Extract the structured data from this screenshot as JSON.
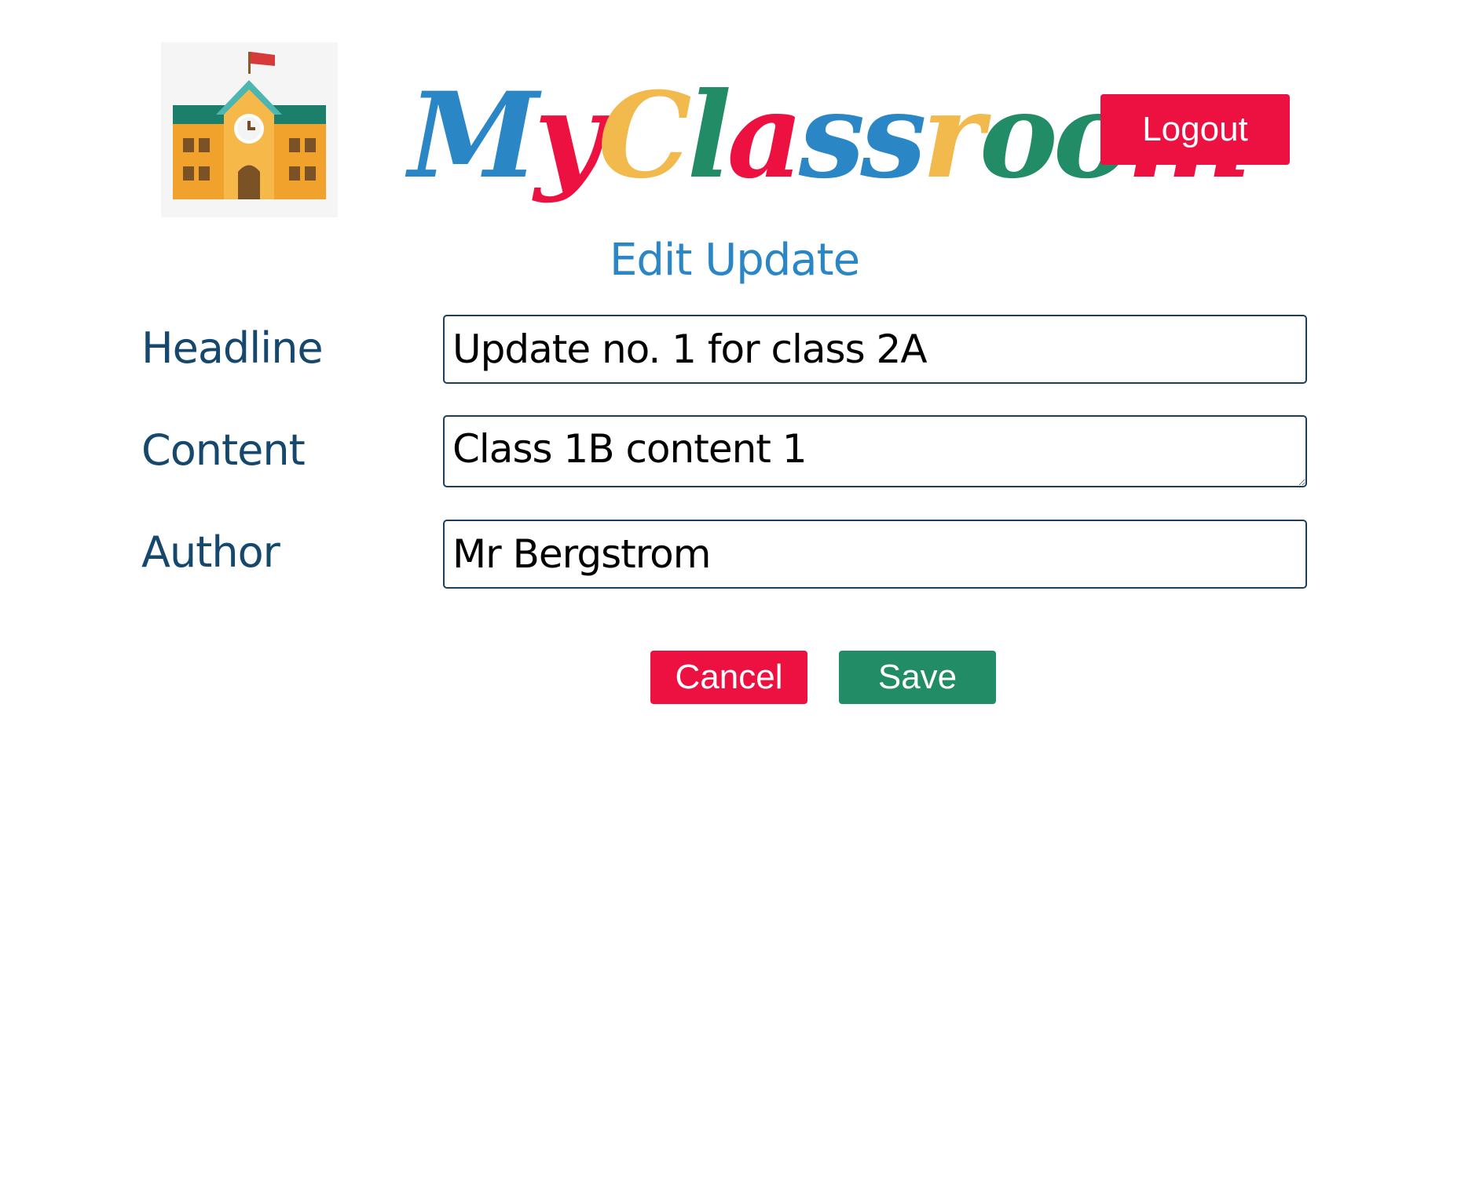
{
  "header": {
    "brand_letters": [
      {
        "char": "M",
        "color": "#2a86c5"
      },
      {
        "char": "y",
        "color": "#ec1140"
      },
      {
        "char": "C",
        "color": "#f2b94c"
      },
      {
        "char": "l",
        "color": "#218c66"
      },
      {
        "char": "a",
        "color": "#ec1140"
      },
      {
        "char": "s",
        "color": "#2a86c5"
      },
      {
        "char": "s",
        "color": "#2a86c5"
      },
      {
        "char": "r",
        "color": "#f2b94c"
      },
      {
        "char": "o",
        "color": "#218c66"
      },
      {
        "char": "o",
        "color": "#218c66"
      },
      {
        "char": "m",
        "color": "#ec1140"
      }
    ],
    "logo_icon": "school-building-icon",
    "logout_label": "Logout"
  },
  "form": {
    "title": "Edit Update",
    "headline": {
      "label": "Headline",
      "value": "Update no. 1 for class 2A"
    },
    "content": {
      "label": "Content",
      "value": "Class 1B content 1"
    },
    "author": {
      "label": "Author",
      "value": "Mr Bergstrom"
    }
  },
  "actions": {
    "cancel_label": "Cancel",
    "save_label": "Save"
  },
  "colors": {
    "accent_red": "#ec1140",
    "accent_green": "#218c66",
    "accent_blue": "#2a86c5",
    "label_navy": "#16486e"
  }
}
